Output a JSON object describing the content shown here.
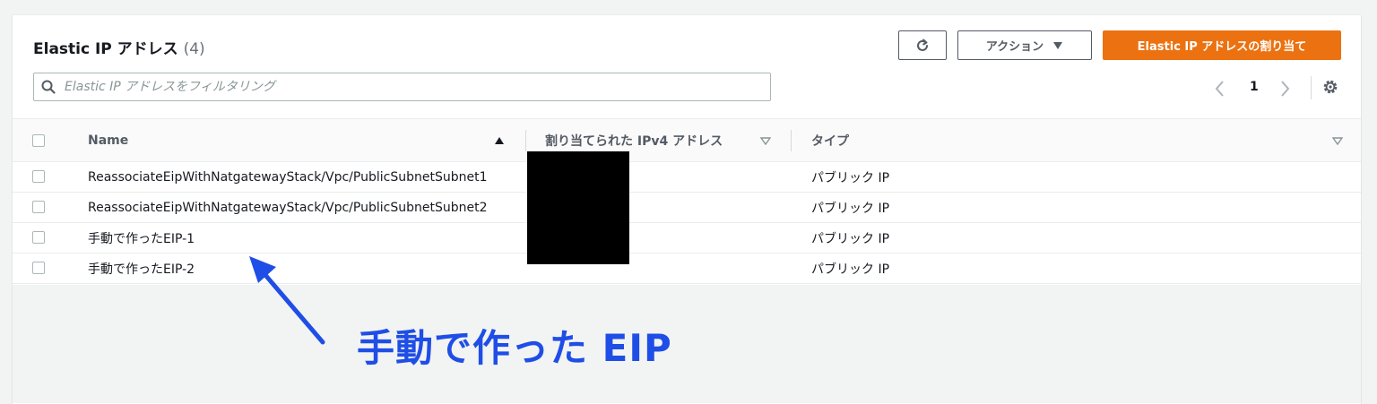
{
  "header": {
    "title": "Elastic IP アドレス",
    "count": "(4)",
    "refresh_icon": "refresh-icon",
    "actions_label": "アクション",
    "allocate_label": "Elastic IP アドレスの割り当て"
  },
  "search": {
    "placeholder": "Elastic IP アドレスをフィルタリング",
    "value": ""
  },
  "pagination": {
    "page": "1",
    "prev": "〈",
    "next": "〉"
  },
  "table": {
    "columns": [
      "Name",
      "割り当てられた IPv4 アドレス",
      "タイプ"
    ],
    "rows": [
      {
        "name": "ReassociateEipWithNatgatewayStack/Vpc/PublicSubnetSubnet1",
        "ipv4": "",
        "type": "パブリック IP"
      },
      {
        "name": "ReassociateEipWithNatgatewayStack/Vpc/PublicSubnetSubnet2",
        "ipv4": "",
        "type": "パブリック IP"
      },
      {
        "name": "手動で作ったEIP-1",
        "ipv4": "",
        "type": "パブリック IP"
      },
      {
        "name": "手動で作ったEIP-2",
        "ipv4": "",
        "type": "パブリック IP"
      }
    ]
  },
  "annotation": {
    "text": "手動で作った EIP"
  },
  "colors": {
    "primary": "#ec7211",
    "annotation": "#1f4ee6"
  }
}
